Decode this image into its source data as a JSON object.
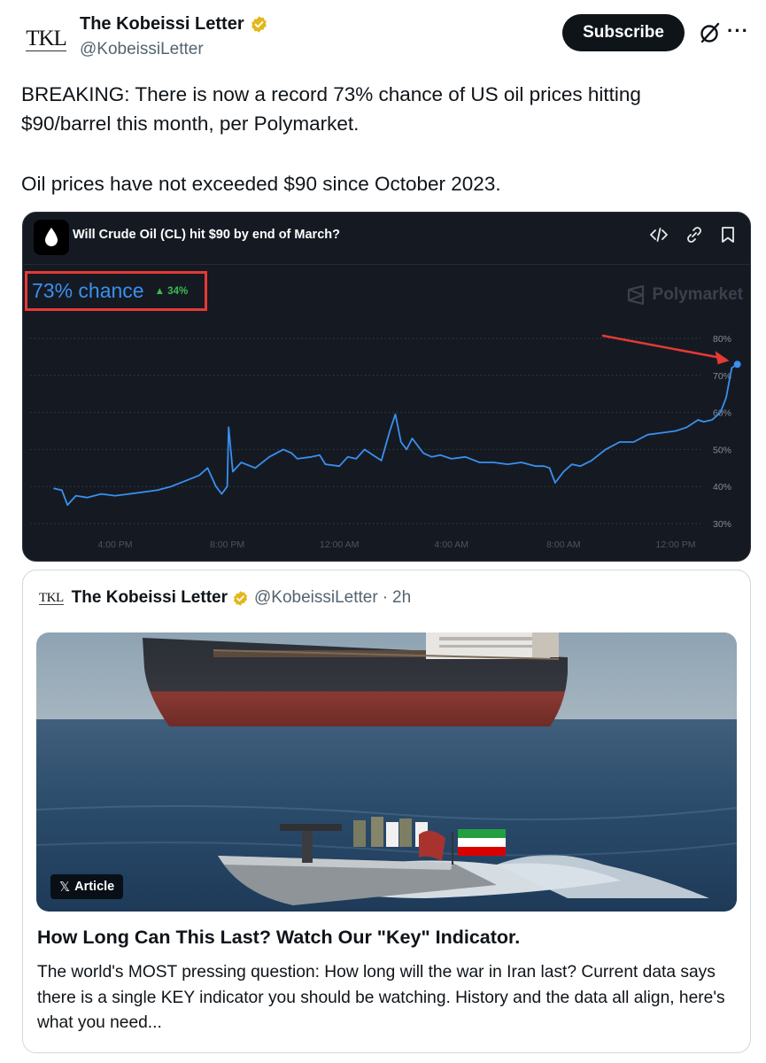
{
  "author": {
    "name": "The Kobeissi Letter",
    "handle": "@KobeissiLetter",
    "logo_text": "TKL",
    "verified_color": "#e2b719"
  },
  "actions": {
    "subscribe_label": "Subscribe",
    "more_label": "···",
    "grok_icon": "grok-icon"
  },
  "tweet": {
    "line1": "BREAKING: There is now a record 73% chance of US oil prices hitting $90/barrel this month, per Polymarket.",
    "line2": "Oil prices have not exceeded $90 since October 2023."
  },
  "chart_card": {
    "question": "Will Crude Oil (CL) hit $90 by end of March?",
    "icons": [
      "embed-icon",
      "link-icon",
      "bookmark-icon"
    ],
    "chance_label": "73% chance",
    "chance_delta": "▲ 34%",
    "watermark": "Polymarket",
    "accent": "#3a8ff0",
    "highlight_box_color": "#e53935"
  },
  "chart_data": {
    "type": "line",
    "title": "Will Crude Oil (CL) hit $90 by end of March?",
    "xlabel": "",
    "ylabel": "",
    "y_unit": "%",
    "ylim": [
      30,
      80
    ],
    "y_ticks": [
      "80%",
      "70%",
      "60%",
      "50%",
      "40%",
      "30%"
    ],
    "y_tick_values": [
      80,
      70,
      60,
      50,
      40,
      30
    ],
    "x_ticks": [
      "4:00 PM",
      "8:00 PM",
      "12:00 AM",
      "4:00 AM",
      "8:00 AM",
      "12:00 PM"
    ],
    "x_tick_hours": [
      16,
      20,
      24,
      28,
      32,
      36
    ],
    "grid": true,
    "series": [
      {
        "color": "#3a8ff0",
        "x_hours": [
          13.8,
          14.1,
          14.3,
          14.6,
          15.0,
          15.5,
          16.0,
          16.5,
          17.0,
          17.5,
          18.0,
          18.5,
          19.0,
          19.3,
          19.6,
          19.8,
          20.0,
          20.05,
          20.2,
          20.5,
          21.0,
          21.5,
          22.0,
          22.3,
          22.5,
          23.0,
          23.3,
          23.5,
          24.0,
          24.3,
          24.6,
          24.9,
          25.2,
          25.5,
          25.8,
          26.0,
          26.2,
          26.4,
          26.6,
          27.0,
          27.3,
          27.6,
          28.0,
          28.5,
          29.0,
          29.5,
          30.0,
          30.5,
          31.0,
          31.3,
          31.5,
          31.7,
          32.0,
          32.3,
          32.6,
          33.0,
          33.5,
          34.0,
          34.5,
          35.0,
          35.5,
          36.0,
          36.4,
          36.8,
          37.0,
          37.3,
          37.6,
          37.8,
          38.0,
          38.1,
          38.2
        ],
        "values": [
          39.5,
          39.0,
          35.0,
          37.5,
          37.0,
          38.0,
          37.5,
          38.0,
          38.5,
          39.0,
          40.0,
          41.5,
          43.0,
          45.0,
          40.0,
          38.0,
          40.0,
          56.0,
          44.0,
          46.5,
          45.0,
          48.0,
          50.0,
          49.0,
          47.5,
          48.0,
          48.5,
          46.0,
          45.5,
          48.0,
          47.5,
          50.0,
          48.5,
          47.0,
          55.0,
          59.5,
          52.0,
          50.0,
          53.0,
          49.0,
          48.0,
          48.5,
          47.5,
          48.0,
          46.5,
          46.5,
          46.0,
          46.5,
          45.5,
          45.5,
          45.0,
          41.0,
          44.0,
          46.0,
          45.5,
          47.0,
          50.0,
          52.0,
          52.0,
          54.0,
          54.5,
          55.0,
          56.0,
          58.0,
          57.5,
          58.0,
          60.0,
          64.0,
          72.0,
          72.5,
          73.0
        ]
      }
    ],
    "last_value": 73
  },
  "quote": {
    "logo_text": "TKL",
    "name": "The Kobeissi Letter",
    "handle": "@KobeissiLetter",
    "separator": "·",
    "time": "2h",
    "badge": "Article",
    "badge_icon": "x-logo-icon",
    "title": "How Long Can This Last? Watch Our \"Key\" Indicator.",
    "description": "The world's MOST pressing question: How long will the war in Iran last? Current data says there is a single KEY indicator you should be watching. History and the data all align, here's what you need..."
  }
}
